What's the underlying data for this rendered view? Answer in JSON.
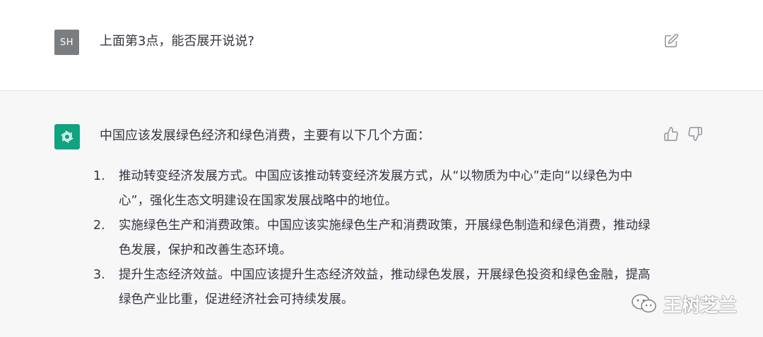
{
  "user_message": {
    "avatar_initials": "SH",
    "text": "上面第3点，能否展开说说?"
  },
  "assistant_message": {
    "intro": "中国应该发展绿色经济和绿色消费，主要有以下几个方面：",
    "items": [
      {
        "num": "1.",
        "text": "推动转变经济发展方式。中国应该推动转变经济发展方式，从“以物质为中心”走向“以绿色为中心”，强化生态文明建设在国家发展战略中的地位。"
      },
      {
        "num": "2.",
        "text": "实施绿色生产和消费政策。中国应该实施绿色生产和消费政策，开展绿色制造和绿色消费，推动绿色发展，保护和改善生态环境。"
      },
      {
        "num": "3.",
        "text": "提升生态经济效益。中国应该提升生态经济效益，推动绿色发展，开展绿色投资和绿色金融，提高绿色产业比重，促进经济社会可持续发展。"
      }
    ]
  },
  "watermark": {
    "text": "王树芝兰"
  },
  "colors": {
    "ai_avatar_bg": "#10a37f",
    "user_avatar_bg": "#7b7e80",
    "assistant_bg": "#f7f7f8",
    "text": "#343541"
  },
  "icons": [
    "edit-icon",
    "openai-logo-icon",
    "thumbs-up-icon",
    "thumbs-down-icon",
    "wechat-icon"
  ]
}
